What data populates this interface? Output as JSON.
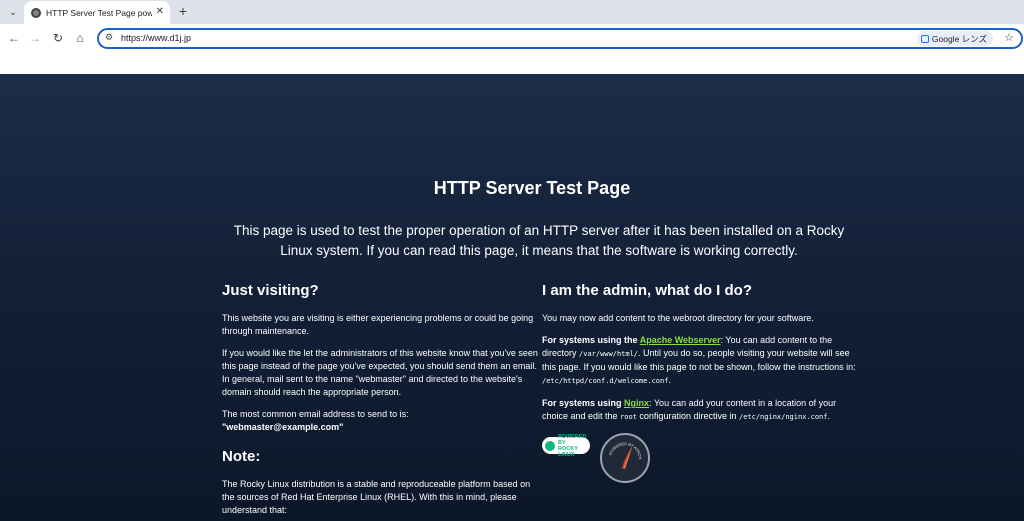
{
  "browser": {
    "tab_title": "HTTP Server Test Page powered by",
    "url": "https://www.d1j.jp",
    "lens_label": "Google レンズ"
  },
  "page": {
    "title": "HTTP Server Test Page",
    "intro": "This page is used to test the proper operation of an HTTP server after it has been installed on a Rocky Linux system. If you can read this page, it means that the software is working correctly.",
    "left": {
      "heading": "Just visiting?",
      "p1": "This website you are visiting is either experiencing problems or could be going through maintenance.",
      "p2": "If you would like the let the administrators of this website know that you've seen this page instead of the page you've expected, you should send them an email. In general, mail sent to the name \"webmaster\" and directed to the website's domain should reach the appropriate person.",
      "p3": "The most common email address to send to is:",
      "email": "\"webmaster@example.com\"",
      "note_heading": "Note:",
      "p4": "The Rocky Linux distribution is a stable and reproduceable platform based on the sources of Red Hat Enterprise Linux (RHEL). With this in mind, please understand that:"
    },
    "right": {
      "heading": "I am the admin, what do I do?",
      "p1": "You may now add content to the webroot directory for your software.",
      "apache_prefix": "For systems using the ",
      "apache_link": "Apache Webserver",
      "apache_text_1": ": You can add content to the directory ",
      "apache_path_1": "/var/www/html/",
      "apache_text_2": ". Until you do so, people visiting your website will see this page. If you would like this page to not be shown, follow the instructions in: ",
      "apache_path_2": "/etc/httpd/conf.d/welcome.conf",
      "apache_text_3": ".",
      "nginx_prefix": "For systems using ",
      "nginx_link": "Nginx",
      "nginx_text_1": ": You can add your content in a location of your choice and edit the ",
      "nginx_root": "root",
      "nginx_text_2": " configuration directive in ",
      "nginx_path": "/etc/nginx/nginx.conf",
      "nginx_text_3": ".",
      "rocky_badge_line1": "POWERED BY",
      "rocky_badge_line2": "ROCKY LINUX",
      "apache_badge": "POWERED BY APACHE"
    }
  },
  "colors": {
    "link": "#8cde3c",
    "page_bg_top": "#1c2d47",
    "page_bg_bottom": "#0c1729",
    "omnibox_border": "#1f5fc8"
  }
}
